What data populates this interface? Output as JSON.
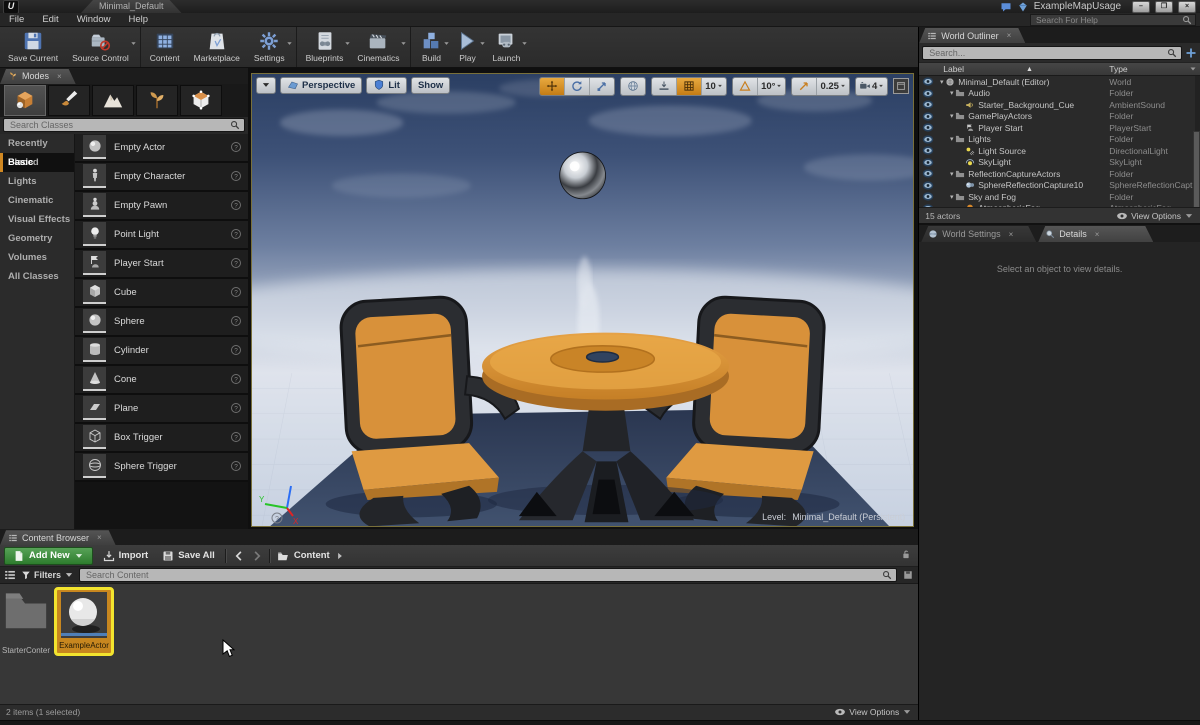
{
  "titlebar": {
    "logo": "U",
    "tab": "Minimal_Default",
    "app_title": "ExampleMapUsage",
    "window_buttons": {
      "minimize": "–",
      "restore": "❐",
      "close": "×"
    }
  },
  "menubar": {
    "items": [
      "File",
      "Edit",
      "Window",
      "Help"
    ],
    "help_search_placeholder": "Search For Help"
  },
  "toolbar": {
    "buttons": [
      {
        "label": "Save Current",
        "icon": "save",
        "caret": false
      },
      {
        "label": "Source Control",
        "icon": "source-control",
        "caret": true
      },
      {
        "label": "Content",
        "icon": "content",
        "caret": false,
        "sep_before": true
      },
      {
        "label": "Marketplace",
        "icon": "marketplace",
        "caret": false
      },
      {
        "label": "Settings",
        "icon": "settings",
        "caret": true
      },
      {
        "label": "Blueprints",
        "icon": "blueprints",
        "caret": true,
        "sep_before": true
      },
      {
        "label": "Cinematics",
        "icon": "cinematics",
        "caret": true
      },
      {
        "label": "Build",
        "icon": "build",
        "caret": true,
        "sep_before": true
      },
      {
        "label": "Play",
        "icon": "play",
        "caret": true
      },
      {
        "label": "Launch",
        "icon": "launch",
        "caret": true
      }
    ]
  },
  "modes_panel": {
    "tab_label": "Modes",
    "close_glyph": "×",
    "mode_tabs": [
      {
        "name": "place-mode",
        "icon": "mode-place",
        "active": true
      },
      {
        "name": "paint-mode",
        "icon": "mode-paint"
      },
      {
        "name": "landscape-mode",
        "icon": "mode-landscape"
      },
      {
        "name": "foliage-mode",
        "icon": "mode-foliage"
      },
      {
        "name": "geometry-mode",
        "icon": "mode-geometry"
      }
    ],
    "search_placeholder": "Search Classes",
    "categories": [
      {
        "label": "Recently Placed"
      },
      {
        "label": "Basic",
        "selected": true
      },
      {
        "label": "Lights"
      },
      {
        "label": "Cinematic"
      },
      {
        "label": "Visual Effects"
      },
      {
        "label": "Geometry"
      },
      {
        "label": "Volumes"
      },
      {
        "label": "All Classes"
      }
    ],
    "items": [
      {
        "label": "Empty Actor",
        "icon": "thumb-sphere"
      },
      {
        "label": "Empty Character",
        "icon": "thumb-character"
      },
      {
        "label": "Empty Pawn",
        "icon": "thumb-pawn"
      },
      {
        "label": "Point Light",
        "icon": "thumb-pointlight"
      },
      {
        "label": "Player Start",
        "icon": "thumb-playerstart"
      },
      {
        "label": "Cube",
        "icon": "thumb-cube"
      },
      {
        "label": "Sphere",
        "icon": "thumb-sphere"
      },
      {
        "label": "Cylinder",
        "icon": "thumb-cylinder"
      },
      {
        "label": "Cone",
        "icon": "thumb-cone"
      },
      {
        "label": "Plane",
        "icon": "thumb-plane"
      },
      {
        "label": "Box Trigger",
        "icon": "thumb-boxtrigger"
      },
      {
        "label": "Sphere Trigger",
        "icon": "thumb-spheretrigger"
      }
    ]
  },
  "viewport": {
    "nav": {
      "perspective": "Perspective",
      "lit": "Lit",
      "show": "Show"
    },
    "snap": {
      "grid": "10",
      "rotation": "10°",
      "scale": "0.25",
      "camera_speed": "4"
    },
    "level_label": "Level:",
    "level_name": "Minimal_Default (Persistent)"
  },
  "outliner": {
    "tab_label": "World Outliner",
    "search_placeholder": "Search...",
    "columns": {
      "label": "Label",
      "type": "Type",
      "sort_indicator": "▲"
    },
    "rows": [
      {
        "indent": 0,
        "expander": "▾",
        "icon": "world",
        "label": "Minimal_Default (Editor)",
        "type": "World"
      },
      {
        "indent": 1,
        "expander": "▾",
        "icon": "folder",
        "label": "Audio",
        "type": "Folder"
      },
      {
        "indent": 2,
        "expander": "",
        "icon": "sound",
        "label": "Starter_Background_Cue",
        "type": "AmbientSound"
      },
      {
        "indent": 1,
        "expander": "▾",
        "icon": "folder",
        "label": "GamePlayActors",
        "type": "Folder"
      },
      {
        "indent": 2,
        "expander": "",
        "icon": "playerstart",
        "label": "Player Start",
        "type": "PlayerStart"
      },
      {
        "indent": 1,
        "expander": "▾",
        "icon": "folder",
        "label": "Lights",
        "type": "Folder"
      },
      {
        "indent": 2,
        "expander": "",
        "icon": "dirlight",
        "label": "Light Source",
        "type": "DirectionalLight"
      },
      {
        "indent": 2,
        "expander": "",
        "icon": "skylight",
        "label": "SkyLight",
        "type": "SkyLight"
      },
      {
        "indent": 1,
        "expander": "▾",
        "icon": "folder",
        "label": "ReflectionCaptureActors",
        "type": "Folder"
      },
      {
        "indent": 2,
        "expander": "",
        "icon": "reflcapture",
        "label": "SphereReflectionCapture10",
        "type": "SphereReflectionCapt"
      },
      {
        "indent": 1,
        "expander": "▾",
        "icon": "folder",
        "label": "Sky and Fog",
        "type": "Folder"
      },
      {
        "indent": 2,
        "expander": "",
        "icon": "fog",
        "label": "AtmosphericFog",
        "type": "AtmosphericFog"
      }
    ],
    "footer": {
      "actor_count": "15 actors",
      "view_options": "View Options"
    }
  },
  "details_panel": {
    "tabs": [
      {
        "label": "World Settings",
        "icon": "world-settings"
      },
      {
        "label": "Details",
        "icon": "details-icon",
        "active": true
      }
    ],
    "close_glyph": "×",
    "empty_message": "Select an object to view details."
  },
  "content_browser": {
    "tab_label": "Content Browser",
    "add_new": "Add New",
    "import": "Import",
    "save_all": "Save All",
    "path": "Content",
    "filters": "Filters",
    "search_placeholder": "Search Content",
    "assets": [
      {
        "label": "StarterContent",
        "icon": "asset-folder"
      },
      {
        "label": "ExampleActor",
        "icon": "asset-sphere",
        "selected": true
      }
    ],
    "status": "2 items (1 selected)",
    "view_options": "View Options"
  },
  "colors": {
    "accent_orange": "#d08822",
    "selection_yellow": "#f3e42e",
    "add_new_green": "#3f8e3f",
    "asset_color_bar": "#4f7fb8"
  }
}
